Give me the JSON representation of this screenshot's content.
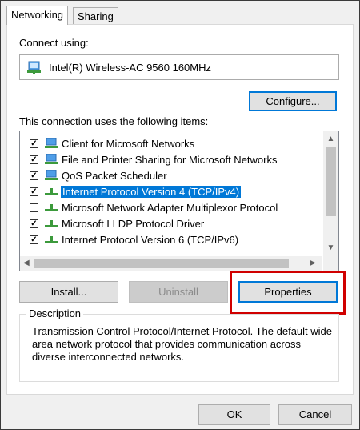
{
  "tabs": [
    {
      "label": "Networking"
    },
    {
      "label": "Sharing"
    }
  ],
  "connect_using_label": "Connect using:",
  "device": {
    "name": "Intel(R) Wireless-AC 9560 160MHz"
  },
  "configure_label": "Configure...",
  "items_label": "This connection uses the following items:",
  "items": [
    {
      "label": "Client for Microsoft Networks",
      "checked": true,
      "icon": "network-client-icon"
    },
    {
      "label": "File and Printer Sharing for Microsoft Networks",
      "checked": true,
      "icon": "network-service-icon"
    },
    {
      "label": "QoS Packet Scheduler",
      "checked": true,
      "icon": "network-service-icon"
    },
    {
      "label": "Internet Protocol Version 4 (TCP/IPv4)",
      "checked": true,
      "selected": true,
      "icon": "protocol-icon"
    },
    {
      "label": "Microsoft Network Adapter Multiplexor Protocol",
      "checked": false,
      "icon": "protocol-icon"
    },
    {
      "label": "Microsoft LLDP Protocol Driver",
      "checked": true,
      "icon": "protocol-icon"
    },
    {
      "label": "Internet Protocol Version 6 (TCP/IPv6)",
      "checked": true,
      "icon": "protocol-icon"
    }
  ],
  "buttons": {
    "install": "Install...",
    "uninstall": "Uninstall",
    "properties": "Properties",
    "ok": "OK",
    "cancel": "Cancel"
  },
  "description": {
    "title": "Description",
    "text": "Transmission Control Protocol/Internet Protocol. The default wide area network protocol that provides communication across diverse interconnected networks."
  },
  "colors": {
    "selection": "#0078d7",
    "highlight_box": "#d00000"
  }
}
